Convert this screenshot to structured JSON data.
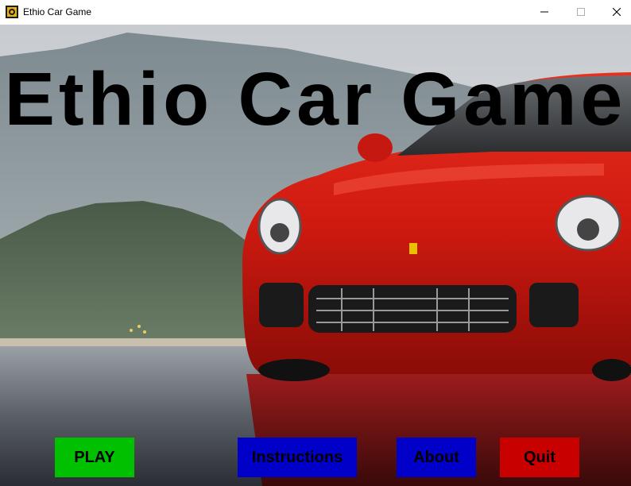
{
  "window": {
    "title": "Ethio Car Game",
    "icon": "car-app-icon",
    "controls": [
      "minimize-icon",
      "maximize-icon",
      "close-icon"
    ]
  },
  "game": {
    "title": "Ethio Car Game",
    "background": "red-sports-car-photo"
  },
  "menu": {
    "play": {
      "label": "PLAY",
      "color": "#00c000"
    },
    "instructions": {
      "label": "Instructions",
      "color": "#0000c8"
    },
    "about": {
      "label": "About",
      "color": "#0000c8"
    },
    "quit": {
      "label": "Quit",
      "color": "#c80000"
    }
  }
}
